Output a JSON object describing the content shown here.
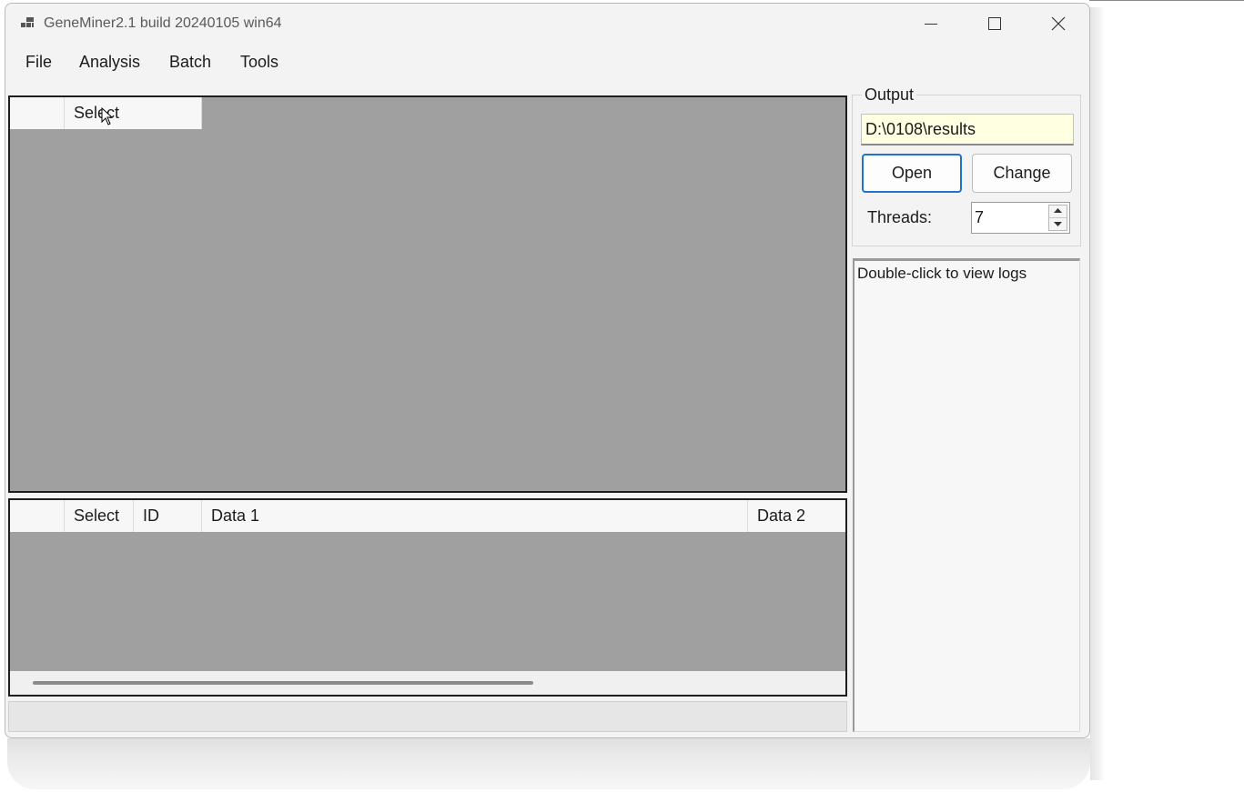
{
  "window": {
    "title": "GeneMiner2.1 build 20240105 win64"
  },
  "menu": [
    "File",
    "Analysis",
    "Batch",
    "Tools"
  ],
  "top_table": {
    "columns": [
      "",
      "Select"
    ]
  },
  "bottom_table": {
    "columns": [
      "",
      "Select",
      "ID",
      "Data 1",
      "Data 2"
    ]
  },
  "output": {
    "group_label": "Output",
    "path": "D:\\0108\\results",
    "open_label": "Open",
    "change_label": "Change",
    "threads_label": "Threads:",
    "threads_value": "7"
  },
  "log": {
    "text": "Double-click to view logs"
  }
}
